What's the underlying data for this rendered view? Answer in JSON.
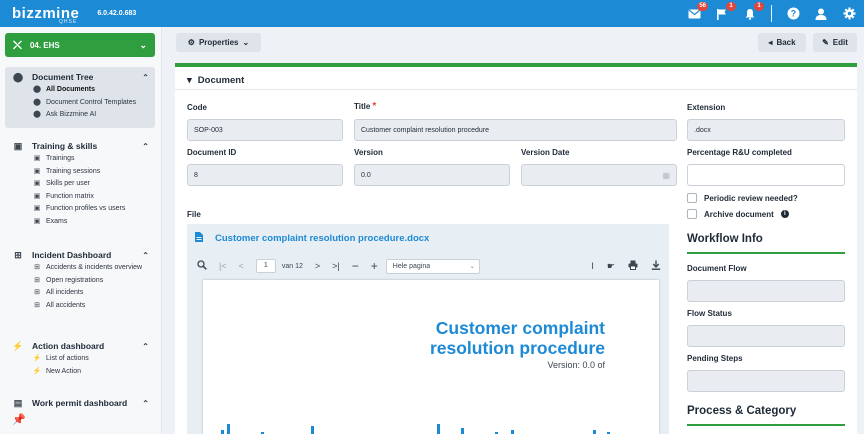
{
  "app": {
    "logo": "bizzmine",
    "logo_sub": "QHSE",
    "version": "6.0.42.0.683"
  },
  "topbar": {
    "mail_badge": "56",
    "flag_badge": "1",
    "bell_badge": "1"
  },
  "sidebar": {
    "module": "04. EHS",
    "groups": [
      {
        "title": "Document Tree",
        "items": [
          "All Documents",
          "Document Control Templates",
          "Ask Bizzmine AI"
        ]
      },
      {
        "title": "Training & skills",
        "items": [
          "Trainings",
          "Training sessions",
          "Skills per user",
          "Function matrix",
          "Function profiles vs users",
          "Exams"
        ]
      },
      {
        "title": "Incident Dashboard",
        "items": [
          "Accidents & incidents overview",
          "Open registrations",
          "All incidents",
          "All accidents"
        ]
      },
      {
        "title": "Action dashboard",
        "items": [
          "List of actions",
          "New Action"
        ]
      },
      {
        "title": "Work permit dashboard",
        "items": []
      }
    ]
  },
  "toolbar": {
    "properties": "Properties",
    "back": "Back",
    "edit": "Edit"
  },
  "section": {
    "title": "Document"
  },
  "form": {
    "code_label": "Code",
    "code_value": "SOP-003",
    "title_label": "Title",
    "title_value": "Customer complaint resolution procedure",
    "extension_label": "Extension",
    "extension_value": ".docx",
    "docid_label": "Document ID",
    "docid_value": "8",
    "version_label": "Version",
    "version_value": "0.0",
    "version_date_label": "Version Date",
    "version_date_value": "",
    "percentage_label": "Percentage R&U completed",
    "percentage_value": "",
    "periodic_review": "Periodic review needed?",
    "archive": "Archive document",
    "file_label": "File"
  },
  "workflow": {
    "heading": "Workflow Info",
    "doc_flow_label": "Document Flow",
    "flow_status_label": "Flow Status",
    "pending_label": "Pending Steps",
    "process_heading": "Process & Category"
  },
  "viewer": {
    "filename": "Customer complaint resolution procedure.docx",
    "page": "1",
    "page_total": "van 12",
    "zoom": "Hele pagina",
    "doc_title_line1": "Customer complaint",
    "doc_title_line2": "resolution procedure",
    "doc_version": "Version: 0.0 of"
  },
  "colors": {
    "topbar": "#1d8ad6",
    "accent_green": "#2f9e3f",
    "badge": "#e0463c"
  }
}
